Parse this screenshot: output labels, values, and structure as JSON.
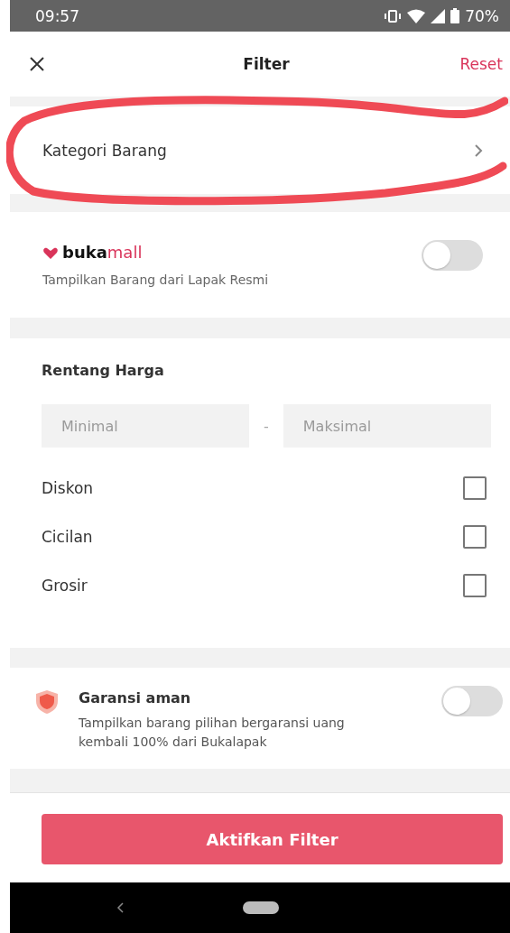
{
  "status_bar": {
    "time": "09:57",
    "battery": "70%"
  },
  "header": {
    "title": "Filter",
    "reset": "Reset"
  },
  "category": {
    "label": "Kategori Barang",
    "highlighted": true
  },
  "bukamall": {
    "brand_bold": "buka",
    "brand_rest": "mall",
    "subtitle": "Tampilkan Barang dari Lapak Resmi",
    "on": false
  },
  "price": {
    "title": "Rentang Harga",
    "min": {
      "placeholder": "Minimal"
    },
    "separator": "-",
    "max": {
      "placeholder": "Maksimal"
    }
  },
  "options": [
    {
      "label": "Diskon",
      "checked": false
    },
    {
      "label": "Cicilan",
      "checked": false
    },
    {
      "label": "Grosir",
      "checked": false
    }
  ],
  "guarantee": {
    "title": "Garansi aman",
    "subtitle": "Tampilkan barang pilihan bergaransi uang kembali 100% dari Bukalapak",
    "on": false
  },
  "apply_button": "Aktifkan Filter"
}
